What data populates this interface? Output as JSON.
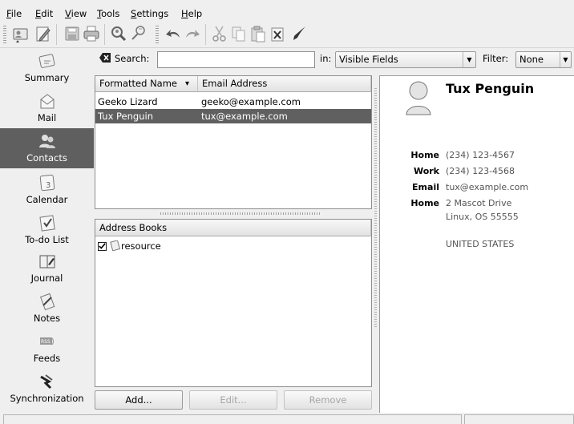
{
  "menubar": {
    "items": [
      {
        "name": "menu-file",
        "label": "File"
      },
      {
        "name": "menu-edit",
        "label": "Edit"
      },
      {
        "name": "menu-view",
        "label": "View"
      },
      {
        "name": "menu-tools",
        "label": "Tools"
      },
      {
        "name": "menu-settings",
        "label": "Settings"
      },
      {
        "name": "menu-help",
        "label": "Help"
      }
    ]
  },
  "toolbar": {
    "icons": [
      "new-contact-icon",
      "edit-contact-icon",
      "save-icon",
      "print-icon",
      "search-people-icon",
      "lookup-icon",
      "undo-icon",
      "redo-icon",
      "cut-icon",
      "copy-icon",
      "paste-icon",
      "delete-icon",
      "jump-icon"
    ]
  },
  "search": {
    "label": "Search:",
    "value": "",
    "in_label": "in:",
    "in_value": "Visible Fields",
    "filter_label": "Filter:",
    "filter_value": "None"
  },
  "sidebar": {
    "items": [
      {
        "name": "summary",
        "label": "Summary",
        "icon": "summary-icon"
      },
      {
        "name": "mail",
        "label": "Mail",
        "icon": "mail-icon"
      },
      {
        "name": "contacts",
        "label": "Contacts",
        "icon": "contacts-icon",
        "active": true
      },
      {
        "name": "calendar",
        "label": "Calendar",
        "icon": "calendar-icon"
      },
      {
        "name": "todo",
        "label": "To-do List",
        "icon": "todo-icon"
      },
      {
        "name": "journal",
        "label": "Journal",
        "icon": "journal-icon"
      },
      {
        "name": "notes",
        "label": "Notes",
        "icon": "notes-icon"
      },
      {
        "name": "feeds",
        "label": "Feeds",
        "icon": "rss-icon"
      },
      {
        "name": "sync",
        "label": "Synchronization",
        "icon": "sync-icon"
      }
    ]
  },
  "contact_list": {
    "columns": [
      "Formatted Name",
      "Email Address"
    ],
    "sort_indicator": "▾",
    "rows": [
      {
        "name": "Geeko Lizard",
        "email": "geeko@example.com",
        "selected": false
      },
      {
        "name": "Tux Penguin",
        "email": "tux@example.com",
        "selected": true
      }
    ]
  },
  "address_books": {
    "header": "Address Books",
    "items": [
      {
        "label": "resource",
        "checked": true
      }
    ]
  },
  "buttons": {
    "add": "Add...",
    "edit": "Edit...",
    "remove": "Remove"
  },
  "detail": {
    "name": "Tux Penguin",
    "fields": [
      {
        "label": "Home",
        "value": "(234) 123-4567"
      },
      {
        "label": "Work",
        "value": "(234) 123-4568"
      },
      {
        "label": "Email",
        "value": "tux@example.com"
      },
      {
        "label": "Home",
        "value": "2 Mascot Drive"
      }
    ],
    "address_line2": "Linux, OS 55555",
    "country": "UNITED STATES"
  },
  "colors": {
    "selection": "#606060",
    "background": "#efefef"
  }
}
